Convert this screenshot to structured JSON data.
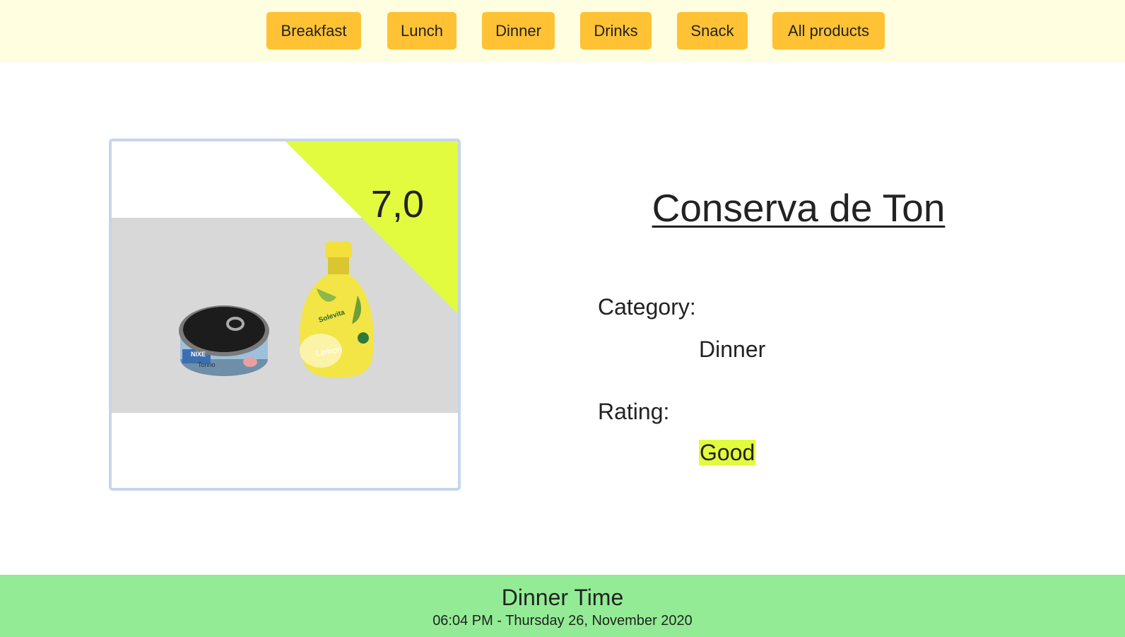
{
  "nav": {
    "items": [
      {
        "label": "Breakfast"
      },
      {
        "label": "Lunch"
      },
      {
        "label": "Dinner"
      },
      {
        "label": "Drinks"
      },
      {
        "label": "Snack"
      },
      {
        "label": "All products"
      }
    ]
  },
  "product": {
    "score": "7,0",
    "name": "Conserva de Ton",
    "category_label": "Category:",
    "category_value": "Dinner",
    "rating_label": "Rating:",
    "rating_value": "Good",
    "image_texts": {
      "can_brand": "NIXE",
      "can_label": "Tonno",
      "bottle_brand": "Solevita",
      "bottle_label": "Lemon"
    }
  },
  "footer": {
    "title": "Dinner Time",
    "datetime": "06:04 PM - Thursday 26, November 2020"
  },
  "colors": {
    "nav_background": "#fffee0",
    "button": "#ffc235",
    "accent": "#e2fb3f",
    "footer": "#93ec95",
    "card_border": "#c6d6ea"
  }
}
